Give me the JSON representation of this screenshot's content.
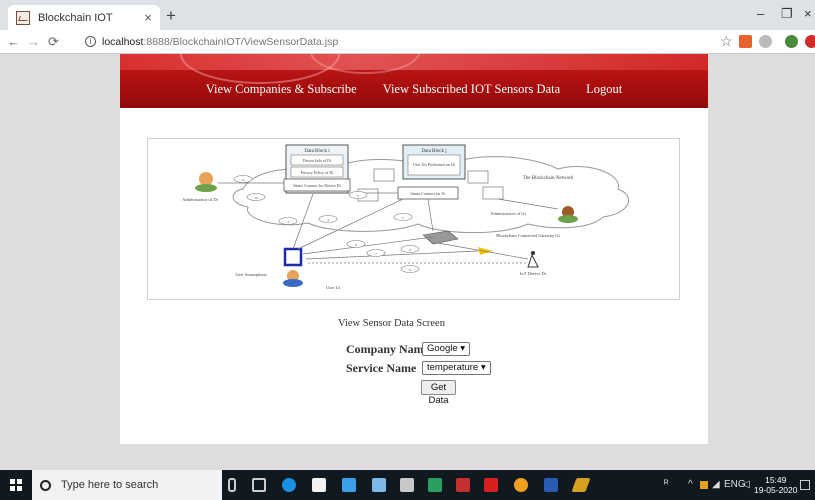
{
  "browser": {
    "tab_title": "Blockchain IOT",
    "tab_close": "×",
    "new_tab": "+",
    "url_prefix": "localhost",
    "url_rest": ":8888/BlockchainIOT/ViewSensorData.jsp"
  },
  "nav": {
    "items": [
      {
        "label": "View Companies & Subscribe"
      },
      {
        "label": "View Subscribed IOT Sensors Data"
      },
      {
        "label": "Logout"
      }
    ]
  },
  "diagram": {
    "labels": {
      "data_block_i": "Data Block i",
      "device_info": "Device Info of Di",
      "privacy_policy": "Privacy Policy of Di",
      "smart_contract_device": "Smart Contract for Device Di",
      "data_block_j": "Data Block j",
      "user_preference": "User Uis Preference on Di",
      "smart_contract_ui": "Smart Contract for Ui",
      "blockchain_network": "The Blockchain Network",
      "admin_di": "Administrator of Di",
      "admin_gi": "Administrator of Gi",
      "gateway": "Blockchain Connected Gateway Gi",
      "user_smartphone": "User Smartphone",
      "user_ui": "User Ui",
      "iot_device": "IoT Device Di"
    },
    "step_numbers": [
      "1a",
      "1b",
      "2",
      "3",
      "4",
      "5",
      "6",
      "7",
      "8",
      "9"
    ]
  },
  "form": {
    "title": "View Sensor Data Screen",
    "company_label": "Company Name",
    "company_value": "Google",
    "service_label": "Service Name",
    "service_value": "temperature",
    "submit_label": "Get Data"
  },
  "taskbar": {
    "search_placeholder": "Type here to search",
    "time": "15:49",
    "date": "19-05-2020"
  },
  "colors": {
    "banner": "#a80e0e",
    "taskbar": "#101820"
  }
}
